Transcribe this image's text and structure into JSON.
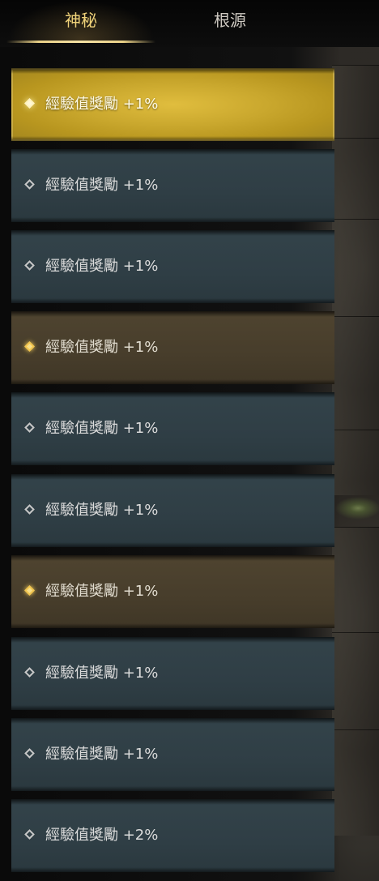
{
  "tabs": [
    {
      "label": "神秘"
    },
    {
      "label": "根源"
    }
  ],
  "rows": [
    {
      "label": "經驗值獎勵 +1%"
    },
    {
      "label": "經驗值獎勵 +1%"
    },
    {
      "label": "經驗值獎勵 +1%"
    },
    {
      "label": "經驗值獎勵 +1%"
    },
    {
      "label": "經驗值獎勵 +1%"
    },
    {
      "label": "經驗值獎勵 +1%"
    },
    {
      "label": "經驗值獎勵 +1%"
    },
    {
      "label": "經驗值獎勵 +1%"
    },
    {
      "label": "經驗值獎勵 +1%"
    },
    {
      "label": "經驗值獎勵 +2%"
    }
  ],
  "colors": {
    "active_tab_text": "#f0d37a",
    "selected_row": "#c9a72d",
    "highlight_row": "#473d2b",
    "plain_row": "#2f3e45"
  }
}
